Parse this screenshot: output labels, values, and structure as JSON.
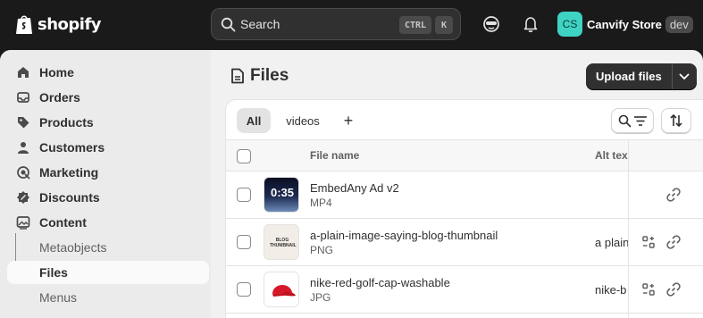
{
  "topbar": {
    "brand": "shopify",
    "search_placeholder": "Search",
    "shortcut_ctrl": "CTRL",
    "shortcut_key": "K",
    "store_initials": "CS",
    "store_name": "Canvify Store",
    "store_badge": "dev",
    "avatar_color": "#3fd3c3"
  },
  "sidebar": {
    "items": [
      {
        "label": "Home",
        "icon": "home-icon"
      },
      {
        "label": "Orders",
        "icon": "inbox-icon"
      },
      {
        "label": "Products",
        "icon": "tag-icon"
      },
      {
        "label": "Customers",
        "icon": "person-icon"
      },
      {
        "label": "Marketing",
        "icon": "target-icon"
      },
      {
        "label": "Discounts",
        "icon": "discount-icon"
      },
      {
        "label": "Content",
        "icon": "image-icon"
      }
    ],
    "subitems": [
      {
        "label": "Metaobjects"
      },
      {
        "label": "Files"
      },
      {
        "label": "Menus"
      }
    ]
  },
  "main": {
    "title": "Files",
    "upload_label": "Upload files",
    "tabs": [
      {
        "label": "All"
      },
      {
        "label": "videos"
      },
      {
        "label": "+"
      }
    ],
    "columns": {
      "file_name": "File name",
      "alt_text": "Alt tex"
    },
    "rows": [
      {
        "name": "EmbedAny Ad v2",
        "type": "MP4",
        "alt": "",
        "thumb_label": "0:35",
        "thumb": "video-thumbnail"
      },
      {
        "name": "a-plain-image-saying-blog-thumbnail",
        "type": "PNG",
        "alt": "a plain",
        "thumb_label": "BLOG THUMBNAIL",
        "thumb": "blog-thumbnail"
      },
      {
        "name": "nike-red-golf-cap-washable",
        "type": "JPG",
        "alt": "nike-b",
        "thumb_label": "",
        "thumb": "red-cap-image"
      }
    ]
  }
}
